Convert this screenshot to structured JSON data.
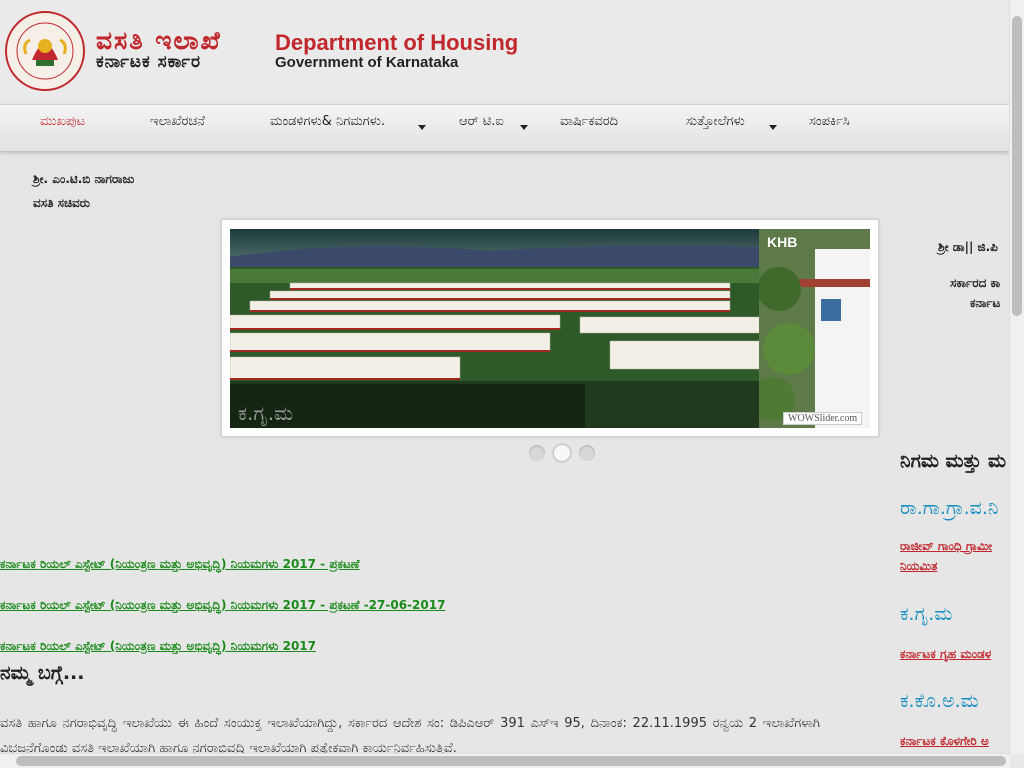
{
  "header": {
    "title_kn": "ವಸತಿ ಇಲಾಖೆ",
    "subtitle_kn": "ಕರ್ನಾಟಕ ಸರ್ಕಾರ",
    "title_en": "Department of Housing",
    "subtitle_en": "Government of Karnataka",
    "emblem_top": "GOVERNMENT OF",
    "emblem_bottom": "KARNATAKA"
  },
  "nav": {
    "items": [
      {
        "label": "ಮುಖಪುಟ"
      },
      {
        "label": "ಇಲಾಖೆರಚನೆ"
      },
      {
        "label": "ಮಂಡಳಿಗಳು& ನಿಗಮಗಳು."
      },
      {
        "label": "ಆರ್ ಟಿ.ಐ"
      },
      {
        "label": "ವಾರ್ಷಿಕವರದಿ"
      },
      {
        "label": "ಸುತ್ತೋಲೆಗಳು"
      },
      {
        "label": "ಸಂಪರ್ಕಿಸಿ"
      }
    ]
  },
  "secretary_left": {
    "name": "ಶ್ರೀ. ಎಂ.ಟಿ.ಬಿ ನಾಗರಾಜು",
    "role": "ವಸತಿ ಸಚಿವರು"
  },
  "secretary_right": {
    "name": "ಶ್ರೀ ಡಾ|| ಜಿ.ಪಿ",
    "role1": "ಸರ್ಕಾರದ ಕಾ",
    "role2": "ಕರ್ನಾಟ"
  },
  "slider": {
    "caption": "ಕ.ಗೃ.ಮ",
    "side_label": "KHB",
    "credit": "WOWSlider.com"
  },
  "links": [
    {
      "text": "ಕರ್ನಾಟಕ ರಿಯಲ್ ಎಸ್ಟೇಟ್ (ನಿಯಂತ್ರಣ ಮತ್ತು ಅಭಿವೃದ್ಧಿ) ನಿಯಮಗಳು 2017 - ಪ್ರಕಟಣೆ"
    },
    {
      "text": "ಕರ್ನಾಟಕ ರಿಯಲ್ ಎಸ್ಟೇಟ್ (ನಿಯಂತ್ರಣ ಮತ್ತು ಅಭಿವೃದ್ಧಿ) ನಿಯಮಗಳು 2017 - ಪ್ರಕಟಣೆ -27-06-2017"
    },
    {
      "text": "ಕರ್ನಾಟಕ ರಿಯಲ್ ಎಸ್ಟೇಟ್ (ನಿಯಂತ್ರಣ ಮತ್ತು ಅಭಿವೃದ್ಧಿ) ನಿಯಮಗಳು 2017"
    }
  ],
  "about": {
    "heading": "ನಮ್ಮ ಬಗ್ಗೆ...",
    "text": "ವಸತಿ ಹಾಗೂ ನಗರಾಭಿವೃದ್ಧಿ ಇಲಾಖೆಯು ಈ ಹಿಂದೆ ಸಂಯುಕ್ತ ಇಲಾಖೆಯಾಗಿದ್ದು, ಸರ್ಕಾರದ ಆದೇಶ ಸಂ: ಡಿಪಿಎಆರ್ 391 ಎಸ್‌ಇ 95, ದಿನಾಂಕ: 22.11.1995 ರನ್ವಯ 2 ಇಲಾಖೆಗಳಾಗಿ ವಿಭಜನೆಗೊಂಡು ವಸತಿ ಇಲಾಖೆಯಾಗಿ ಹಾಗೂ ನಗರಾಭಿವ್ರದ್ಧಿ ಇಲಾಖೆಯಾಗಿ ಪ್ರತ್ಯೇಕವಾಗಿ ಕಾರ್ಯನಿರ್ವಹಿಸುತ್ತಿವೆ."
  },
  "corporations": {
    "heading": "ನಿಗಮ ಮತ್ತು ಮ",
    "items": [
      {
        "abbr": "ರಾ.ಗಾ.ಗ್ರಾ.ವ.ನಿ",
        "name1": "ರಾಜೀವ್ ಗಾಂಧಿ ಗ್ರಾಮೀ",
        "name2": "ನಿಯಮಿತ"
      },
      {
        "abbr": "ಕ.ಗೃ.ಮ",
        "name1": "ಕರ್ನಾಟಕ ಗೃಹ ಮಂಡಳ"
      },
      {
        "abbr": "ಕ.ಕೊ.ಅ.ಮ",
        "name1": "ಕರ್ನಾಟಕ ಕೊಳಗೇರಿ ಅ"
      }
    ]
  },
  "colors": {
    "brand_red": "#c0282d",
    "link_green": "#1a8a1a",
    "corp_blue": "#1a8fc0"
  }
}
